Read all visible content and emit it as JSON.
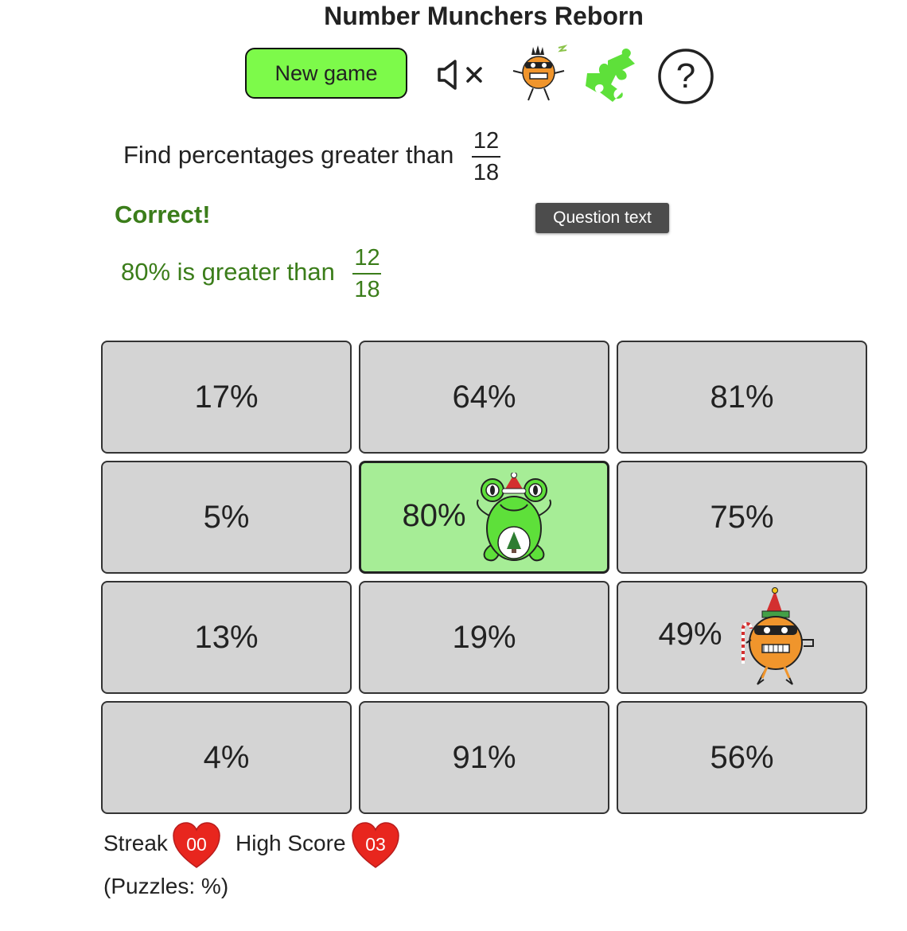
{
  "app": {
    "title": "Number Munchers Reborn"
  },
  "toolbar": {
    "new_game_label": "New game",
    "mute_icon": "speaker-muted-icon",
    "character_icon": "muncher-character-icon",
    "puzzle_icon": "puzzle-piece-icon",
    "help_icon": "question-mark-icon",
    "help_glyph": "?"
  },
  "question": {
    "prefix": "Find percentages greater than",
    "numerator": "12",
    "denominator": "18"
  },
  "feedback": {
    "status": "Correct!",
    "text": "80% is greater than",
    "numerator": "12",
    "denominator": "18"
  },
  "tooltip": {
    "text": "Question text"
  },
  "grid": {
    "rows": [
      [
        "17%",
        "64%",
        "81%"
      ],
      [
        "5%",
        "80%",
        "75%"
      ],
      [
        "13%",
        "19%",
        "49%"
      ],
      [
        "4%",
        "91%",
        "56%"
      ]
    ],
    "selected_cell": "80%",
    "frog_cell": "80%",
    "muncher_cell": "49%"
  },
  "footer": {
    "streak_label": "Streak",
    "streak_value": "00",
    "high_score_label": "High Score",
    "high_score_value": "03",
    "puzzles_text": "(Puzzles: %)"
  },
  "colors": {
    "accent_green": "#7dfa4a",
    "correct_green": "#3b7d1a",
    "cell_gray": "#d4d4d4",
    "selected_cell": "#a6ed96",
    "heart_red": "#e8261e",
    "puzzle_green": "#5ee03a",
    "muncher_orange": "#f0952c"
  }
}
